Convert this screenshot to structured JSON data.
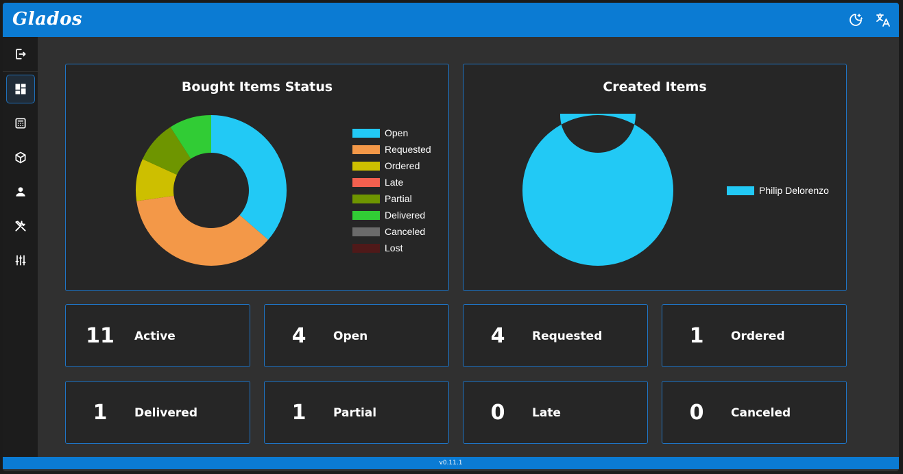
{
  "app": {
    "brand": "Glados",
    "version": "v0.11.1"
  },
  "topbar": {
    "icons": [
      {
        "name": "theme-toggle-icon",
        "icon": "moon-stars"
      },
      {
        "name": "translate-icon",
        "icon": "translate"
      }
    ]
  },
  "sidebar": {
    "items": [
      {
        "name": "logout",
        "icon": "logout-icon",
        "active": false
      },
      {
        "name": "dashboard",
        "icon": "dashboard-icon",
        "active": true
      },
      {
        "name": "calculator",
        "icon": "calculator-icon",
        "active": false
      },
      {
        "name": "items",
        "icon": "package-icon",
        "active": false
      },
      {
        "name": "users",
        "icon": "user-icon",
        "active": false
      },
      {
        "name": "tools",
        "icon": "tools-icon",
        "active": false
      },
      {
        "name": "settings",
        "icon": "sliders-icon",
        "active": false
      }
    ]
  },
  "chart_data": [
    {
      "type": "pie",
      "title": "Bought Items Status",
      "categories": [
        "Open",
        "Requested",
        "Ordered",
        "Late",
        "Partial",
        "Delivered",
        "Canceled",
        "Lost"
      ],
      "values": [
        4,
        4,
        1,
        0,
        1,
        1,
        0,
        0
      ],
      "colors": [
        "#22c9f5",
        "#f39848",
        "#cdbf00",
        "#f3604f",
        "#6e9500",
        "#31cc35",
        "#6b6b6b",
        "#4f1919"
      ],
      "legend": "right"
    },
    {
      "type": "pie",
      "title": "Created Items",
      "categories": [
        "Philip Delorenzo"
      ],
      "values": [
        1
      ],
      "colors": [
        "#22c9f5"
      ],
      "legend": "right"
    }
  ],
  "stats": [
    {
      "value": "11",
      "label": "Active"
    },
    {
      "value": "4",
      "label": "Open"
    },
    {
      "value": "4",
      "label": "Requested"
    },
    {
      "value": "1",
      "label": "Ordered"
    },
    {
      "value": "1",
      "label": "Delivered"
    },
    {
      "value": "1",
      "label": "Partial"
    },
    {
      "value": "0",
      "label": "Late"
    },
    {
      "value": "0",
      "label": "Canceled"
    }
  ]
}
